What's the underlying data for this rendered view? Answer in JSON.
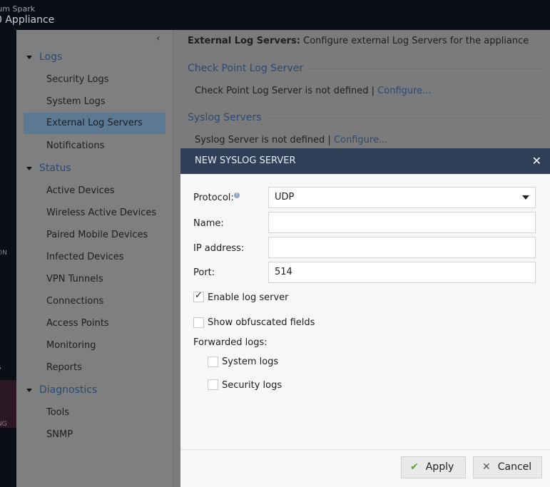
{
  "app": {
    "brand_line1": "tum Spark",
    "brand_line2": "0 Appliance"
  },
  "leftnav": {
    "fragments": [
      "ON",
      "S",
      "NG"
    ]
  },
  "sidebar": {
    "collapse_icon": "chevron-left",
    "sections": [
      {
        "label": "Logs",
        "items": [
          "Security Logs",
          "System Logs",
          "External Log Servers",
          "Notifications"
        ]
      },
      {
        "label": "Status",
        "items": [
          "Active Devices",
          "Wireless Active Devices",
          "Paired Mobile Devices",
          "Infected Devices",
          "VPN Tunnels",
          "Connections",
          "Access Points",
          "Monitoring",
          "Reports"
        ]
      },
      {
        "label": "Diagnostics",
        "items": [
          "Tools",
          "SNMP"
        ]
      }
    ],
    "selected": "External Log Servers"
  },
  "content": {
    "header_bold": "External Log Servers:",
    "header_text": " Configure external Log Servers for the appliance",
    "checkpoint": {
      "title": "Check Point Log Server",
      "status": "Check Point Log Server is not defined | ",
      "link": "Configure..."
    },
    "syslog": {
      "title": "Syslog Servers",
      "status": "Syslog Server is not defined | ",
      "link": "Configure..."
    }
  },
  "modal": {
    "title": "NEW SYSLOG SERVER",
    "protocol_label": "Protocol:",
    "protocol_value": "UDP",
    "name_label": "Name:",
    "name_value": "",
    "ip_label": "IP address:",
    "ip_value": "",
    "port_label": "Port:",
    "port_value": "514",
    "enable_label": "Enable log server",
    "enable_checked": true,
    "obfuscated_label": "Show obfuscated fields",
    "obfuscated_checked": false,
    "forwarded_label": "Forwarded logs:",
    "system_logs_label": "System logs",
    "system_logs_checked": false,
    "security_logs_label": "Security logs",
    "security_logs_checked": false,
    "apply_label": "Apply",
    "cancel_label": "Cancel",
    "colors": {
      "header": "#2f3f58",
      "apply_check": "#5aaa2a"
    }
  }
}
